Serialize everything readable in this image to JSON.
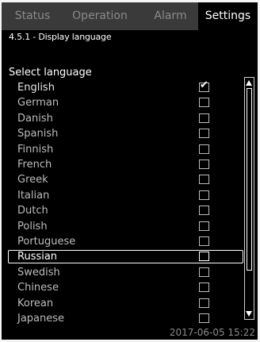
{
  "tabs": [
    {
      "label": "Status"
    },
    {
      "label": "Operation"
    },
    {
      "label": "Alarm"
    },
    {
      "label": "Settings"
    }
  ],
  "breadcrumb": "4.5.1 - Display language",
  "section_title": "Select language",
  "languages": [
    {
      "label": "English",
      "checked": true
    },
    {
      "label": "German",
      "checked": false
    },
    {
      "label": "Danish",
      "checked": false
    },
    {
      "label": "Spanish",
      "checked": false
    },
    {
      "label": "Finnish",
      "checked": false
    },
    {
      "label": "French",
      "checked": false
    },
    {
      "label": "Greek",
      "checked": false
    },
    {
      "label": "Italian",
      "checked": false
    },
    {
      "label": "Dutch",
      "checked": false
    },
    {
      "label": "Polish",
      "checked": false
    },
    {
      "label": "Portuguese",
      "checked": false
    },
    {
      "label": "Russian",
      "checked": false,
      "focused": true
    },
    {
      "label": "Swedish",
      "checked": false
    },
    {
      "label": "Chinese",
      "checked": false
    },
    {
      "label": "Korean",
      "checked": false
    },
    {
      "label": "Japanese",
      "checked": false
    }
  ],
  "datetime": "2017-06-05 15:22",
  "colors": {
    "background": "#000000",
    "tab_bar": "#3a3a3a",
    "inactive_text": "#8a8a8a",
    "text": "#ffffff"
  }
}
